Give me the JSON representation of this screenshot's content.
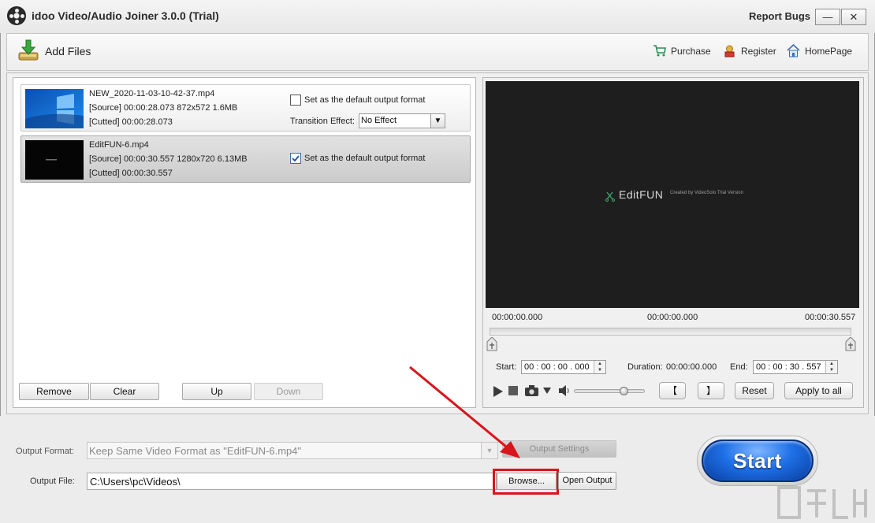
{
  "app": {
    "title": "idoo Video/Audio Joiner 3.0.0 (Trial)",
    "report_bugs": "Report Bugs",
    "minimize": "—",
    "close": "✕"
  },
  "toolbar": {
    "add_files": "Add Files",
    "links": [
      {
        "label": "Purchase",
        "icon": "cart-icon"
      },
      {
        "label": "Register",
        "icon": "register-icon"
      },
      {
        "label": "HomePage",
        "icon": "home-icon"
      }
    ]
  },
  "files": [
    {
      "name": "NEW_2020-11-03-10-42-37.mp4",
      "source": "[Source]  00:00:28.073  872x572  1.6MB",
      "cutted": "[Cutted]  00:00:28.073",
      "default_format_label": "Set as the default output format",
      "default_format_checked": false,
      "transition_label": "Transition Effect:",
      "transition_value": "No Effect"
    },
    {
      "name": "EditFUN-6.mp4",
      "source": "[Source]  00:00:30.557  1280x720  6.13MB",
      "cutted": "[Cutted]  00:00:30.557",
      "default_format_label": "Set as the default output format",
      "default_format_checked": true
    }
  ],
  "list_buttons": {
    "remove": "Remove",
    "clear": "Clear",
    "up": "Up",
    "down": "Down"
  },
  "preview": {
    "video_logo": "EditFUN",
    "video_caption": "Created by VideoSolo Trial Version",
    "time_left": "00:00:00.000",
    "time_center": "00:00:00.000",
    "time_right": "00:00:30.557",
    "start_label": "Start:",
    "start_value": "00 : 00 : 00 . 000",
    "duration_label": "Duration:",
    "duration_value": "00:00:00.000",
    "end_label": "End:",
    "end_value": "00 : 00 : 30 . 557",
    "bracket_left": "【",
    "bracket_right": "】",
    "reset": "Reset",
    "apply_to_all": "Apply to all",
    "volume_level": 0.7
  },
  "output": {
    "format_label": "Output Format:",
    "format_value": "Keep Same Video Format as \"EditFUN-6.mp4\"",
    "settings_button": "Output Settings",
    "file_label": "Output File:",
    "file_value": "C:\\Users\\pc\\Videos\\",
    "browse_button": "Browse...",
    "open_output_button": "Open Output"
  },
  "start_button": "Start",
  "colors": {
    "accent_blue": "#1e6fe6",
    "highlight_red": "#d9141b",
    "video_bg": "#1e1e1e"
  }
}
